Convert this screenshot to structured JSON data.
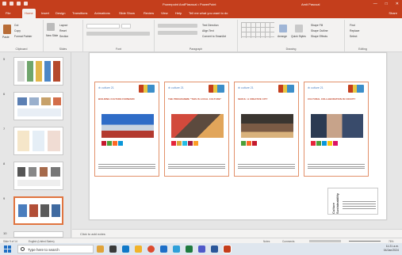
{
  "window": {
    "title": "Powerpoint AndPlasnual   •   PowerPoint",
    "user": "Amit Pascual",
    "controls": [
      "—",
      "□",
      "✕"
    ]
  },
  "tabs": [
    "File",
    "Home",
    "Insert",
    "Design",
    "Transitions",
    "Animations",
    "Slide Show",
    "Review",
    "View",
    "Help",
    "Tell me what you want to do"
  ],
  "active_tab": "Home",
  "share_label": "Share",
  "ribbon": {
    "clipboard": {
      "paste": "Paste",
      "cut": "Cut",
      "copy": "Copy",
      "format_painter": "Format Painter",
      "label": "Clipboard"
    },
    "slides": {
      "new_slide": "New Slide",
      "layout": "Layout",
      "reset": "Reset",
      "section": "Section",
      "label": "Slides"
    },
    "font": {
      "label": "Font"
    },
    "paragraph": {
      "text_direction": "Text Direction",
      "align_text": "Align Text",
      "convert_smartart": "Convert to SmartArt",
      "label": "Paragraph"
    },
    "drawing": {
      "arrange": "Arrange",
      "quick_styles": "Quick Styles",
      "shape_fill": "Shape Fill",
      "shape_outline": "Shape Outline",
      "shape_effects": "Shape Effects",
      "label": "Drawing"
    },
    "editing": {
      "find": "Find",
      "replace": "Replace",
      "select": "Select",
      "label": "Editing"
    }
  },
  "thumbnails": [
    {
      "num": "5"
    },
    {
      "num": "6"
    },
    {
      "num": "7"
    },
    {
      "num": "8"
    },
    {
      "num": "9"
    },
    {
      "num": "10"
    }
  ],
  "cards": [
    {
      "logo": "⊕ culture 21",
      "title": "BUILDING CULTURE FORWARD"
    },
    {
      "logo": "⊕ culture 21",
      "title": "THE PROGRAMME \"THIS IS LOCAL CULTURE\""
    },
    {
      "logo": "⊕ culture 21",
      "title": "SEOUL: A CREATIVE CITY"
    },
    {
      "logo": "⊕ culture 21",
      "title": "CULTURAL COLLABORATION IN COUNTY"
    }
  ],
  "right_card_vertical_text": "Culture Sustainability",
  "notes_placeholder": "Click to add notes",
  "status": {
    "slide_info": "Slide 9 of 14",
    "language": "English (United States)",
    "notes": "Notes",
    "comments": "Comments",
    "zoom": "76%"
  },
  "taskbar": {
    "search_placeholder": "Type here to search",
    "time": "11:21 a.m.",
    "date": "04/Jan/2024"
  },
  "colors": {
    "accent": "#c43e1c",
    "card_border": "#e2916a",
    "selection": "#e0743f"
  }
}
